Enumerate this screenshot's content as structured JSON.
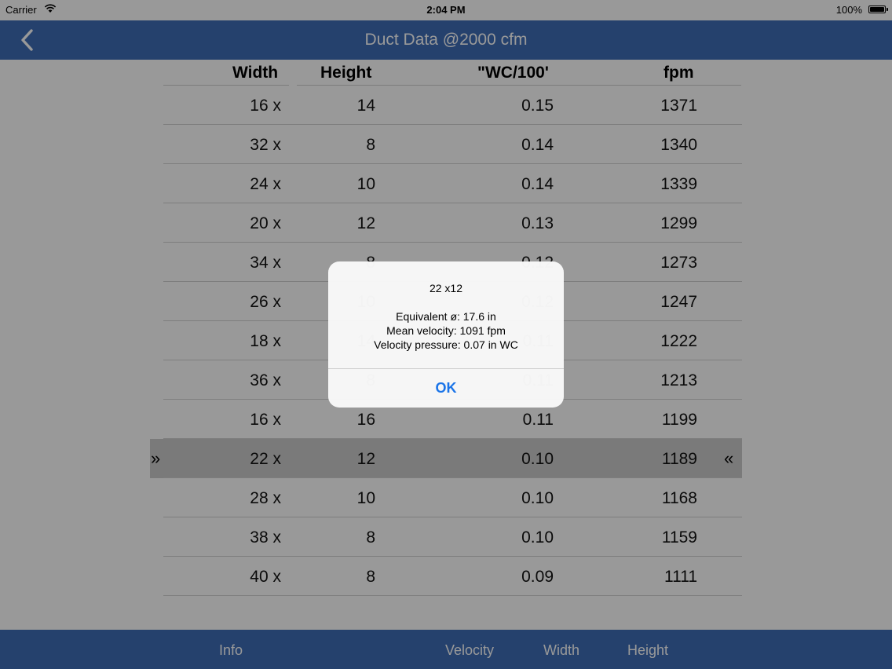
{
  "status_bar": {
    "carrier": "Carrier",
    "time": "2:04 PM",
    "battery": "100%"
  },
  "nav": {
    "title": "Duct Data @2000 cfm"
  },
  "table": {
    "headers": {
      "width": "Width",
      "height": "Height",
      "wc": "\"WC/100'",
      "fpm": "fpm"
    },
    "rows": [
      {
        "width": "16 x",
        "height": "14",
        "wc": "0.15",
        "fpm": "1371"
      },
      {
        "width": "32 x",
        "height": "8",
        "wc": "0.14",
        "fpm": "1340"
      },
      {
        "width": "24 x",
        "height": "10",
        "wc": "0.14",
        "fpm": "1339"
      },
      {
        "width": "20 x",
        "height": "12",
        "wc": "0.13",
        "fpm": "1299"
      },
      {
        "width": "34 x",
        "height": "8",
        "wc": "0.12",
        "fpm": "1273"
      },
      {
        "width": "26 x",
        "height": "10",
        "wc": "0.12",
        "fpm": "1247"
      },
      {
        "width": "18 x",
        "height": "14",
        "wc": "0.11",
        "fpm": "1222"
      },
      {
        "width": "36 x",
        "height": "8",
        "wc": "0.11",
        "fpm": "1213"
      },
      {
        "width": "16 x",
        "height": "16",
        "wc": "0.11",
        "fpm": "1199"
      },
      {
        "width": "22 x",
        "height": "12",
        "wc": "0.10",
        "fpm": "1189"
      },
      {
        "width": "28 x",
        "height": "10",
        "wc": "0.10",
        "fpm": "1168"
      },
      {
        "width": "38 x",
        "height": "8",
        "wc": "0.10",
        "fpm": "1159"
      },
      {
        "width": "40 x",
        "height": "8",
        "wc": "0.09",
        "fpm": "1111"
      }
    ],
    "selected_markers": {
      "left": "»",
      "right": "«"
    }
  },
  "tab_bar": {
    "info": "Info",
    "velocity": "Velocity",
    "width": "Width",
    "height": "Height"
  },
  "alert": {
    "title": "22 x12",
    "line1": "Equivalent ø: 17.6 in",
    "line2": "Mean velocity:   1091 fpm",
    "line3": "Velocity pressure: 0.07 in WC",
    "ok": "OK"
  },
  "colors": {
    "bar": "#3e6db6",
    "accent": "#1a74e8",
    "selected_row": "#cccccc"
  }
}
